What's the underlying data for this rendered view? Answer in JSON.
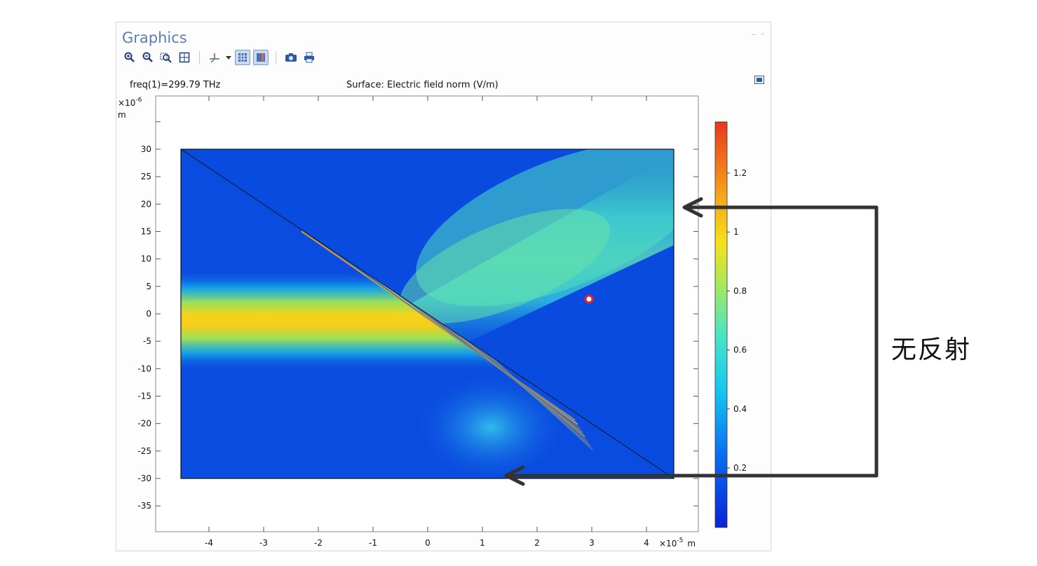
{
  "panel": {
    "title": "Graphics"
  },
  "toolbar": {
    "icons": [
      "zoom-in-icon",
      "zoom-out-icon",
      "zoom-box-icon",
      "zoom-extents-icon",
      "axis-orientation-icon",
      "dropdown-arrow-icon",
      "grid-toggle-icon",
      "legend-toggle-icon",
      "camera-icon",
      "print-icon"
    ]
  },
  "plot": {
    "freq_label": "freq(1)=299.79 THz",
    "surface_label": "Surface: Electric field norm (V/m)",
    "y_exponent": "×10",
    "y_exponent_power": "-6",
    "y_unit": "m",
    "x_exponent": "×10",
    "x_exponent_power": "-5",
    "x_unit": "m",
    "y_ticks": [
      "30",
      "25",
      "20",
      "15",
      "10",
      "5",
      "0",
      "-5",
      "-10",
      "-15",
      "-20",
      "-25",
      "-30",
      "-35"
    ],
    "x_ticks": [
      "-4",
      "-3",
      "-2",
      "-1",
      "0",
      "1",
      "2",
      "3",
      "4"
    ],
    "colorbar_ticks": [
      "1.2",
      "1",
      "0.8",
      "0.6",
      "0.4",
      "0.2"
    ],
    "colors": {
      "colorbar_top": "#e8371e",
      "colorbar_bottom": "#0a22d8",
      "field_background": "#0a4ce0"
    }
  },
  "annotation": {
    "text": "无反射"
  }
}
